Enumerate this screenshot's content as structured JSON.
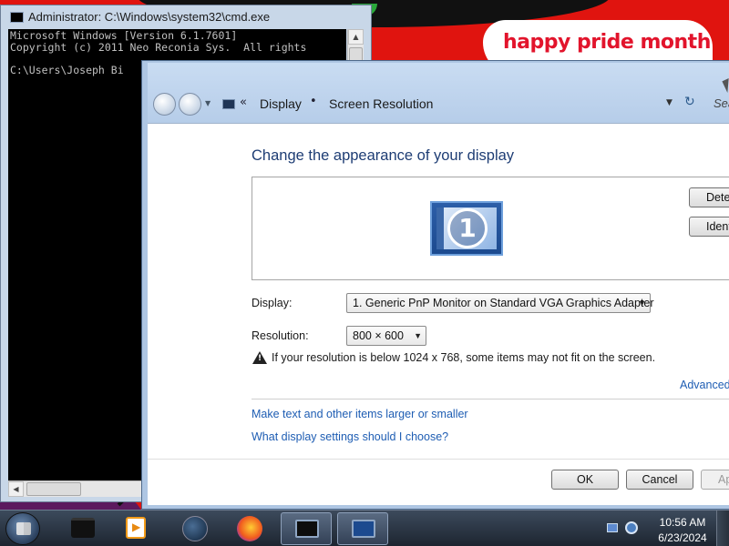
{
  "desktop": {
    "note_text": "happy pride month"
  },
  "cmd_window": {
    "title": "Administrator: C:\\Windows\\system32\\cmd.exe",
    "lines": [
      "Microsoft Windows [Version 6.1.7601]",
      "Copyright (c) 2011 Neo Reconia Sys.  All rights",
      "",
      "C:\\Users\\Joseph Bi"
    ]
  },
  "display_window": {
    "breadcrumb": {
      "item1": "Display",
      "separator": "•",
      "item2": "Screen Resolution",
      "chevrons": "«"
    },
    "search_hint": "Sea",
    "heading": "Change the appearance of your display",
    "monitor_number": "1",
    "detect_label": "Detect",
    "identify_label": "Identify",
    "display_label": "Display:",
    "display_value": "1. Generic PnP Monitor on Standard VGA Graphics Adapter",
    "resolution_label": "Resolution:",
    "resolution_value": "800 × 600",
    "warning": "If your resolution is below 1024 x 768, some items may not fit on the screen.",
    "advanced_link": "Advanced",
    "text_size_link": "Make text and other items larger or smaller",
    "choose_link": "What display settings should I choose?",
    "ok_label": "OK",
    "cancel_label": "Cancel",
    "apply_label": "Apply"
  },
  "taskbar": {
    "time": "10:56 AM",
    "date": "6/23/2024",
    "items": [
      "folder-icon",
      "media-player-icon",
      "internet-explorer-icon",
      "firefox-icon",
      "cmd-icon",
      "display-settings-icon"
    ]
  },
  "colors": {
    "desktop_red": "#e0140f",
    "pride_text": "#e2142c",
    "heading_blue": "#1e3d74",
    "link_blue": "#1e5db3"
  }
}
